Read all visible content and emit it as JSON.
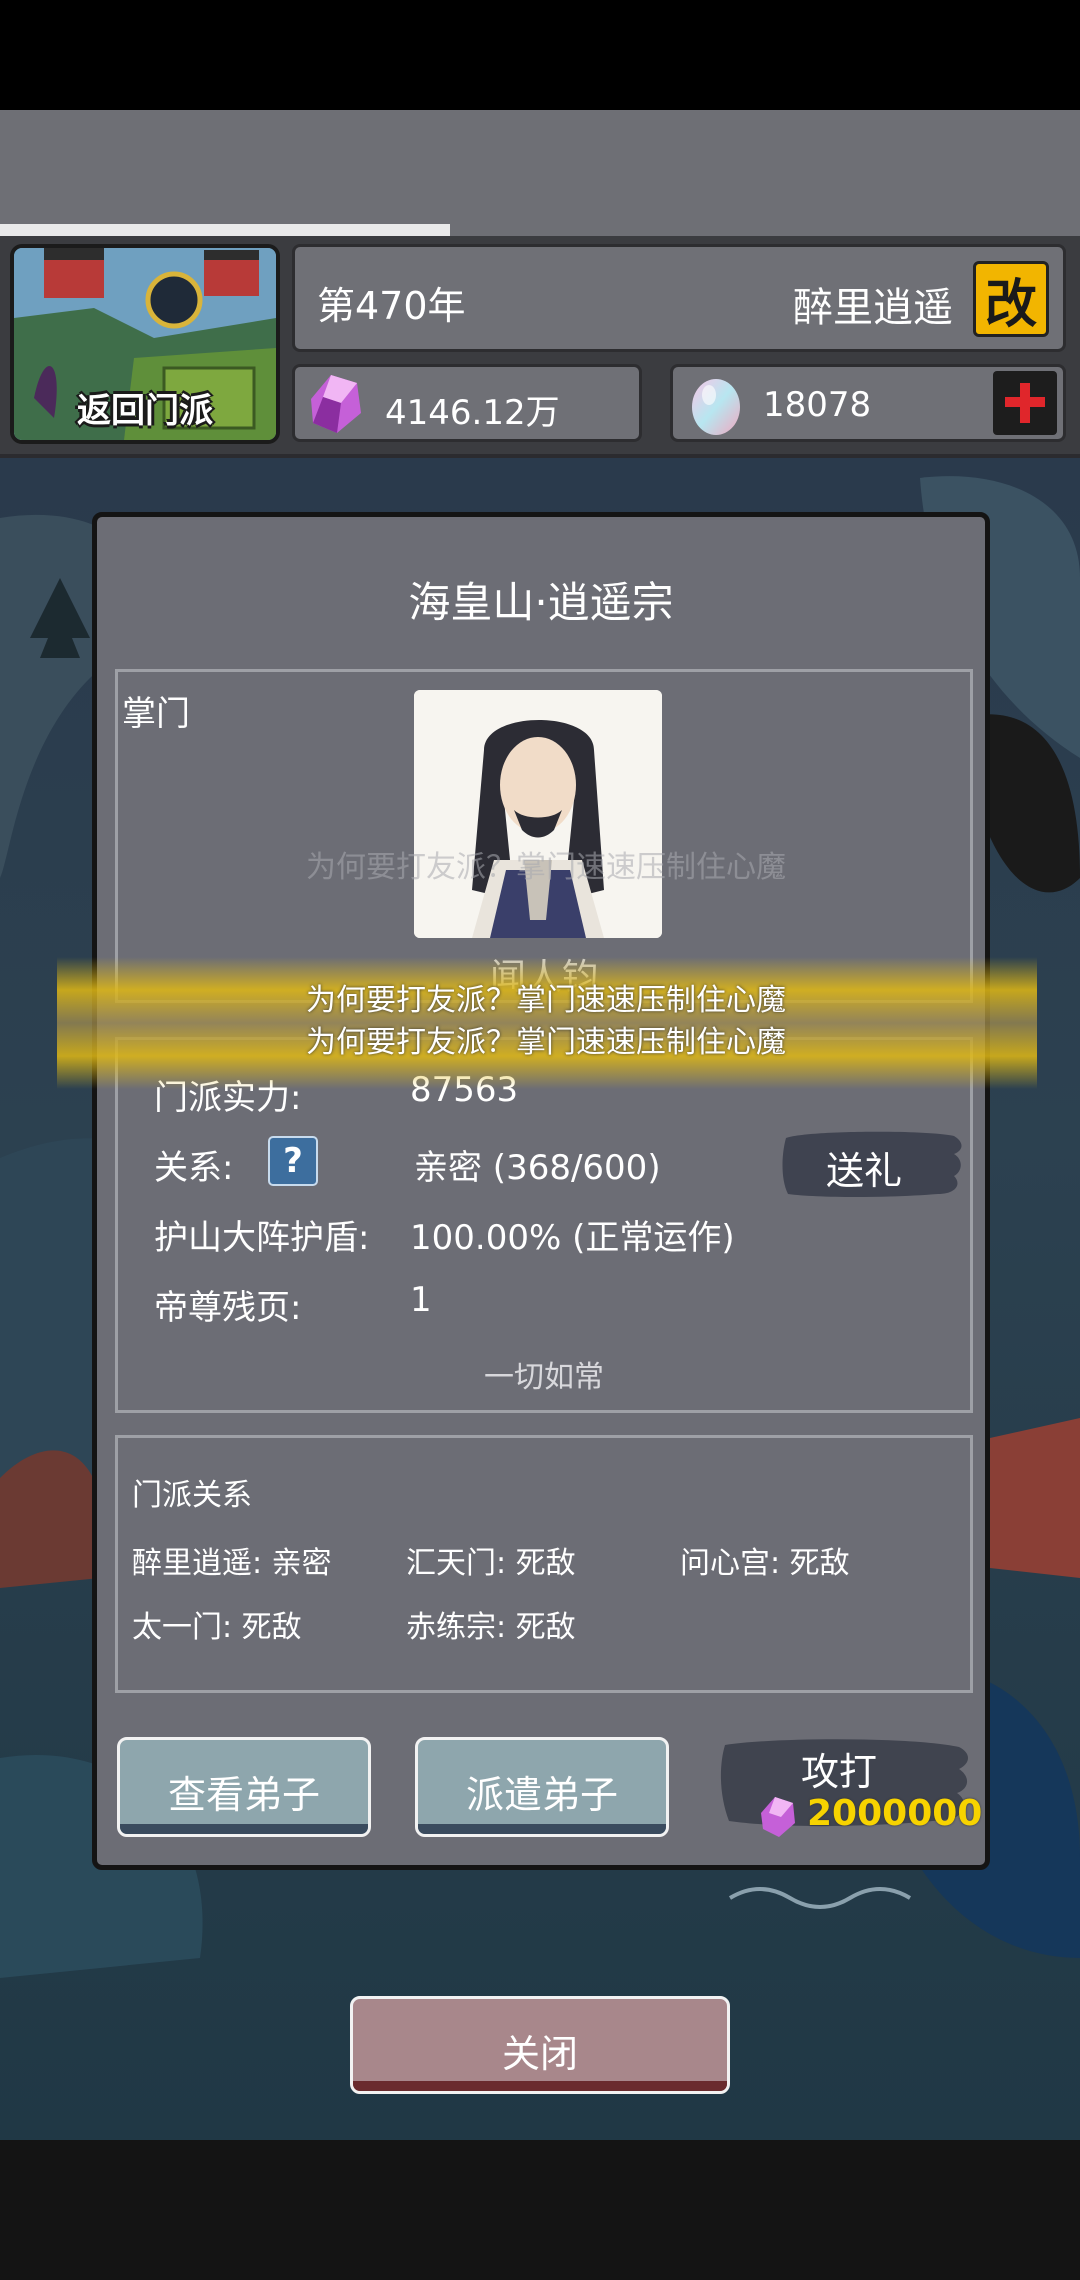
{
  "header": {
    "back_label": "返回门派",
    "year": "第470年",
    "player_name": "醉里逍遥",
    "rename_label": "改",
    "spirit_stones": "4146.12万",
    "gems": "18078"
  },
  "dialog": {
    "title": "海皇山·逍遥宗",
    "leader_label": "掌门",
    "leader_name": "闻人钧",
    "ghost_message": "为何要打友派？掌门速速压制住心魔",
    "banner_lines": [
      "为何要打友派？掌门速速压制住心魔",
      "为何要打友派？掌门速速压制住心魔"
    ],
    "info": {
      "strength_key": "门派实力:",
      "strength_val": "87563",
      "relation_key": "关系:",
      "relation_val": "亲密  (368/600)",
      "help_label": "?",
      "gift_label": "送礼",
      "shield_key": "护山大阵护盾:",
      "shield_val": "100.00% (正常运作)",
      "pages_key": "帝尊残页:",
      "pages_val": "1",
      "status": "一切如常"
    },
    "relations": {
      "title": "门派关系",
      "items": [
        "醉里逍遥: 亲密",
        "汇天门: 死敌",
        "问心宫: 死敌",
        "太一门: 死敌",
        "赤练宗: 死敌"
      ]
    },
    "buttons": {
      "view_disciples": "查看弟子",
      "dispatch_disciples": "派遣弟子",
      "attack": "攻打",
      "attack_cost": "2000000"
    }
  },
  "close_label": "关闭"
}
